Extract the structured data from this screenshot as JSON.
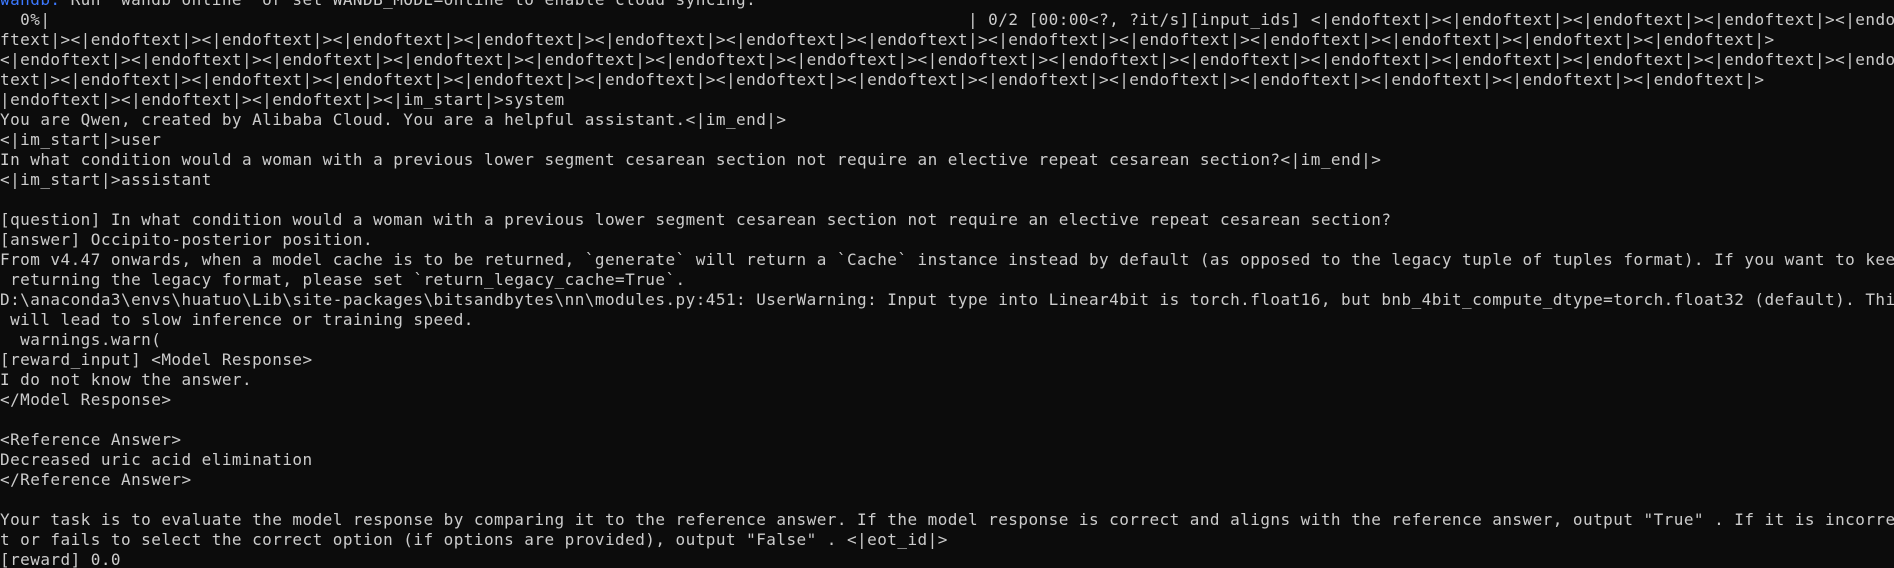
{
  "terminal": {
    "wandb_line": {
      "prefix": "wandb:",
      "text": " Run `wandb online` or set WANDB_MODE=online to enable cloud syncing."
    },
    "progress": {
      "left": "  0%|",
      "right": "| 0/2 [00:00<?, ?it/s][input_ids] <|endoftext|><|endoftext|><|endoftext|><|endoftext|><|endo"
    },
    "token_lines": [
      "ftext|><|endoftext|><|endoftext|><|endoftext|><|endoftext|><|endoftext|><|endoftext|><|endoftext|><|endoftext|><|endoftext|><|endoftext|><|endoftext|><|endoftext|><|endoftext|>",
      "<|endoftext|><|endoftext|><|endoftext|><|endoftext|><|endoftext|><|endoftext|><|endoftext|><|endoftext|><|endoftext|><|endoftext|><|endoftext|><|endoftext|><|endoftext|><|endoftext|><|endoftext|>",
      "text|><|endoftext|><|endoftext|><|endoftext|><|endoftext|><|endoftext|><|endoftext|><|endoftext|><|endoftext|><|endoftext|><|endoftext|><|endoftext|><|endoftext|><|endoftext|>",
      "|endoftext|><|endoftext|><|endoftext|><|im_start|>system"
    ],
    "system_line": "You are Qwen, created by Alibaba Cloud. You are a helpful assistant.<|im_end|>",
    "user_tag": "<|im_start|>user",
    "user_question": "In what condition would a woman with a previous lower segment cesarean section not require an elective repeat cesarean section?<|im_end|>",
    "assistant_tag": "<|im_start|>assistant",
    "question_line": "[question] In what condition would a woman with a previous lower segment cesarean section not require an elective repeat cesarean section?",
    "answer_line": "[answer] Occipito-posterior position.",
    "cache_warning_1": "From v4.47 onwards, when a model cache is to be returned, `generate` will return a `Cache` instance instead by default (as opposed to the legacy tuple of tuples format). If you want to keep",
    "cache_warning_2": " returning the legacy format, please set `return_legacy_cache=True`.",
    "user_warning_1": "D:\\anaconda3\\envs\\huatuo\\Lib\\site-packages\\bitsandbytes\\nn\\modules.py:451: UserWarning: Input type into Linear4bit is torch.float16, but bnb_4bit_compute_dtype=torch.float32 (default). This",
    "user_warning_2": " will lead to slow inference or training speed.",
    "warnings_warn": "  warnings.warn(",
    "reward_input": "[reward_input] <Model Response>",
    "model_response": "I do not know the answer.",
    "model_response_close": "</Model Response>",
    "reference_open": "<Reference Answer>",
    "reference_answer": "Decreased uric acid elimination",
    "reference_close": "</Reference Answer>",
    "task_line_1": "Your task is to evaluate the model response by comparing it to the reference answer. If the model response is correct and aligns with the reference answer, output \"True\" . If it is incorrec",
    "task_line_2": "t or fails to select the correct option (if options are provided), output \"False\" . <|eot_id|>",
    "reward_line": "[reward] 0.0"
  }
}
